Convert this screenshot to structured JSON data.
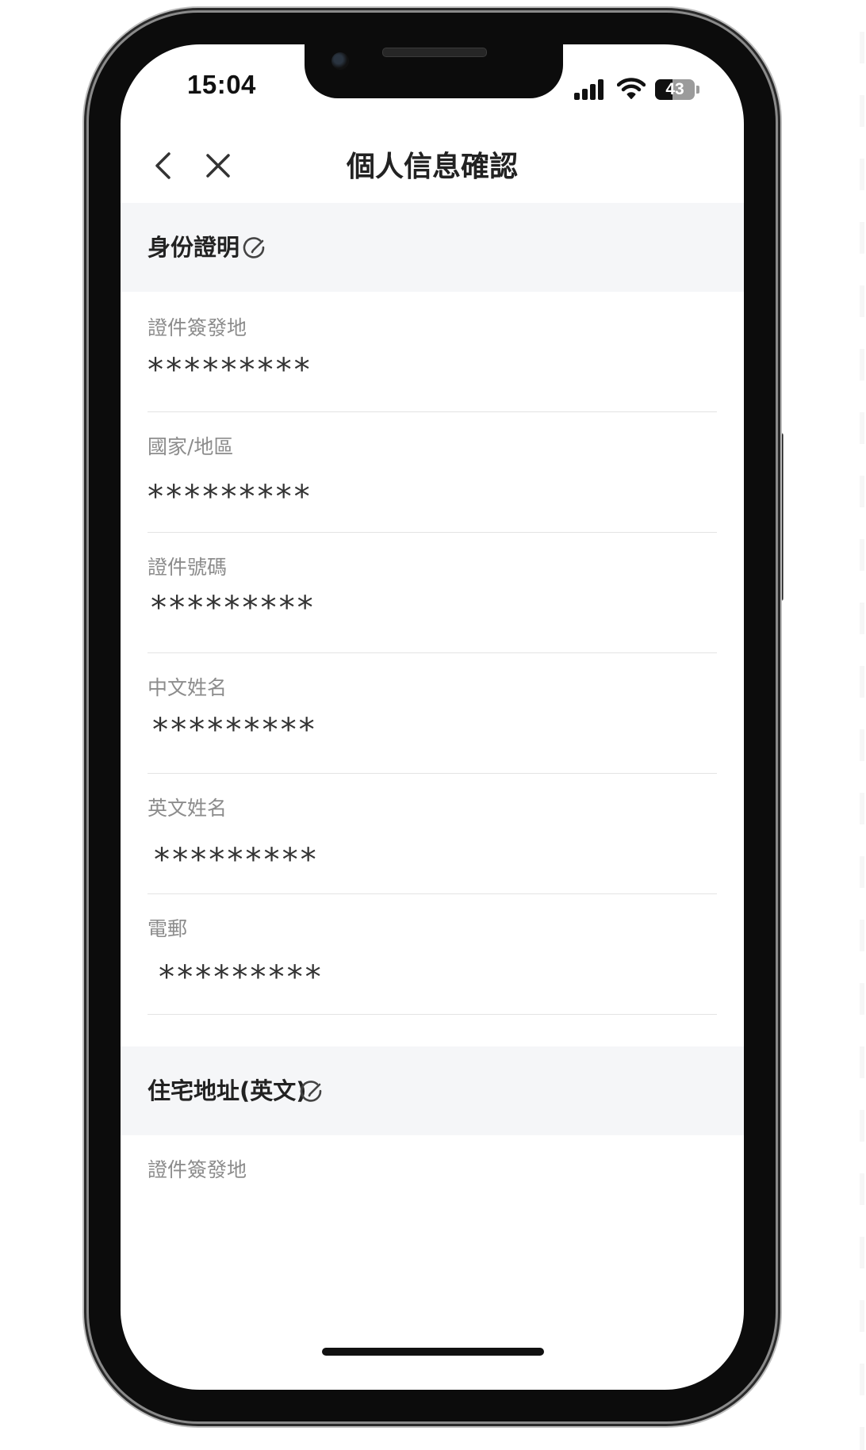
{
  "status": {
    "time": "15:04",
    "battery": "43",
    "battery_fraction": 0.43
  },
  "nav": {
    "back_icon": "chevron-left-icon",
    "close_icon": "close-icon",
    "title": "個人信息確認"
  },
  "sections": [
    {
      "title": "身份證明",
      "edit_icon": "edit-icon",
      "fields": [
        {
          "label": "證件簽發地",
          "value": "*********"
        },
        {
          "label": "國家/地區",
          "value": "*********"
        },
        {
          "label": "證件號碼",
          "value": "*********"
        },
        {
          "label": "中文姓名",
          "value": "*********"
        },
        {
          "label": "英文姓名",
          "value": "*********"
        },
        {
          "label": "電郵",
          "value": "*********"
        }
      ]
    },
    {
      "title": "住宅地址(英文)",
      "edit_icon": "edit-icon",
      "fields": [
        {
          "label": "證件簽發地"
        }
      ]
    }
  ],
  "colors": {
    "section_bg": "#f5f6f8",
    "label": "#8c8c8c",
    "value": "#333333",
    "title": "#222222",
    "divider": "#e3e3e3"
  }
}
